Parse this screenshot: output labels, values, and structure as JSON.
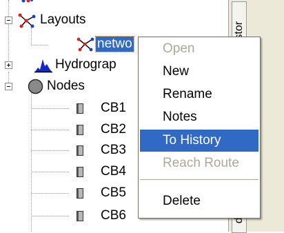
{
  "tree": {
    "layouts_label": "Layouts",
    "layout_item_label": "netwo",
    "hydrographs_label": "Hydrograp",
    "nodes_label": "Nodes",
    "nodes": [
      "CB1",
      "CB2",
      "CB3",
      "CB4",
      "CB5",
      "CB6"
    ]
  },
  "side_tabs": {
    "top": "istor",
    "bottom": "dr"
  },
  "context_menu": {
    "open": "Open",
    "new": "New",
    "rename": "Rename",
    "notes": "Notes",
    "to_history": "To History",
    "reach_route": "Reach Route",
    "delete": "Delete"
  },
  "colors": {
    "selection": "#316ac5",
    "disabled_text": "#aca899"
  }
}
